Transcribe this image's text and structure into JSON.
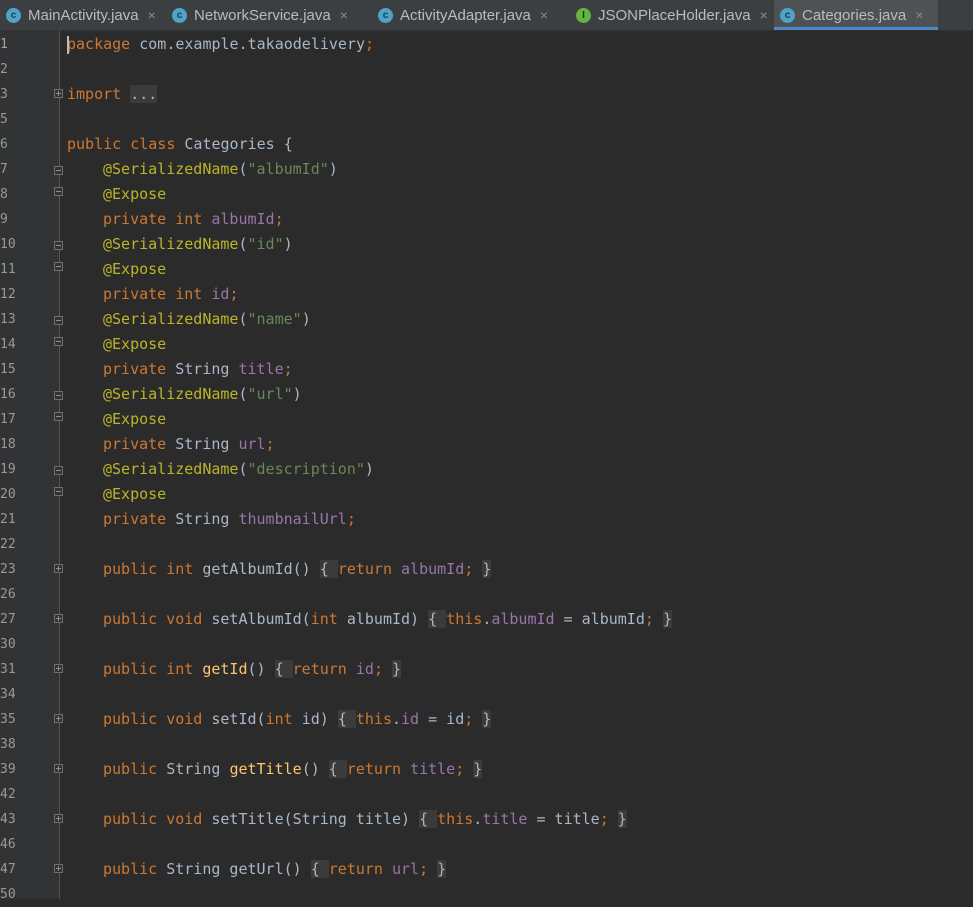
{
  "tabs": [
    {
      "label": "MainActivity.java",
      "icon": "class-icon",
      "active": false
    },
    {
      "label": "NetworkService.java",
      "icon": "class-icon",
      "active": false
    },
    {
      "label": "ActivityAdapter.java",
      "icon": "class-icon",
      "active": false
    },
    {
      "label": "JSONPlaceHolder.java",
      "icon": "interface-icon",
      "active": false
    },
    {
      "label": "Categories.java",
      "icon": "class-icon",
      "active": true
    }
  ],
  "tab_icon_letters": {
    "class": "c",
    "interface": "I"
  },
  "close_glyph": "×",
  "lines": [
    {
      "n": "1",
      "fold": "",
      "tokens": [
        [
          "kw",
          "package"
        ],
        [
          "plain",
          " com.example.takaodelivery"
        ],
        [
          "punct",
          ";"
        ]
      ]
    },
    {
      "n": "2",
      "fold": "",
      "tokens": []
    },
    {
      "n": "3",
      "fold": "plus",
      "tokens": [
        [
          "kw",
          "import"
        ],
        [
          "plain",
          " "
        ],
        [
          "folded",
          "..."
        ]
      ]
    },
    {
      "n": "5",
      "fold": "",
      "tokens": []
    },
    {
      "n": "6",
      "fold": "",
      "tokens": [
        [
          "kw",
          "public class"
        ],
        [
          "plain",
          " Categories {"
        ]
      ]
    },
    {
      "n": "7",
      "fold": "open",
      "indent": 1,
      "tokens": [
        [
          "ann",
          "@SerializedName"
        ],
        [
          "plain",
          "("
        ],
        [
          "str",
          "\"albumId\""
        ],
        [
          "plain",
          ")"
        ]
      ]
    },
    {
      "n": "8",
      "fold": "close",
      "indent": 1,
      "tokens": [
        [
          "ann",
          "@Expose"
        ]
      ]
    },
    {
      "n": "9",
      "fold": "",
      "indent": 1,
      "tokens": [
        [
          "kw",
          "private int "
        ],
        [
          "fld",
          "albumId"
        ],
        [
          "punct",
          ";"
        ]
      ]
    },
    {
      "n": "10",
      "fold": "open",
      "indent": 1,
      "tokens": [
        [
          "ann",
          "@SerializedName"
        ],
        [
          "plain",
          "("
        ],
        [
          "str",
          "\"id\""
        ],
        [
          "plain",
          ")"
        ]
      ]
    },
    {
      "n": "11",
      "fold": "close",
      "indent": 1,
      "tokens": [
        [
          "ann",
          "@Expose"
        ]
      ]
    },
    {
      "n": "12",
      "fold": "",
      "indent": 1,
      "tokens": [
        [
          "kw",
          "private int "
        ],
        [
          "fld",
          "id"
        ],
        [
          "punct",
          ";"
        ]
      ]
    },
    {
      "n": "13",
      "fold": "open",
      "indent": 1,
      "tokens": [
        [
          "ann",
          "@SerializedName"
        ],
        [
          "plain",
          "("
        ],
        [
          "str",
          "\"name\""
        ],
        [
          "plain",
          ")"
        ]
      ]
    },
    {
      "n": "14",
      "fold": "close",
      "indent": 1,
      "tokens": [
        [
          "ann",
          "@Expose"
        ]
      ]
    },
    {
      "n": "15",
      "fold": "",
      "indent": 1,
      "tokens": [
        [
          "kw",
          "private "
        ],
        [
          "plain",
          "String "
        ],
        [
          "fld",
          "title"
        ],
        [
          "punct",
          ";"
        ]
      ]
    },
    {
      "n": "16",
      "fold": "open",
      "indent": 1,
      "tokens": [
        [
          "ann",
          "@SerializedName"
        ],
        [
          "plain",
          "("
        ],
        [
          "str",
          "\"url\""
        ],
        [
          "plain",
          ")"
        ]
      ]
    },
    {
      "n": "17",
      "fold": "close",
      "indent": 1,
      "tokens": [
        [
          "ann",
          "@Expose"
        ]
      ]
    },
    {
      "n": "18",
      "fold": "",
      "indent": 1,
      "tokens": [
        [
          "kw",
          "private "
        ],
        [
          "plain",
          "String "
        ],
        [
          "fld",
          "url"
        ],
        [
          "punct",
          ";"
        ]
      ]
    },
    {
      "n": "19",
      "fold": "open",
      "indent": 1,
      "tokens": [
        [
          "ann",
          "@SerializedName"
        ],
        [
          "plain",
          "("
        ],
        [
          "str",
          "\"description\""
        ],
        [
          "plain",
          ")"
        ]
      ]
    },
    {
      "n": "20",
      "fold": "close",
      "indent": 1,
      "tokens": [
        [
          "ann",
          "@Expose"
        ]
      ]
    },
    {
      "n": "21",
      "fold": "",
      "indent": 1,
      "tokens": [
        [
          "kw",
          "private "
        ],
        [
          "plain",
          "String "
        ],
        [
          "fld",
          "thumbnailUrl"
        ],
        [
          "punct",
          ";"
        ]
      ]
    },
    {
      "n": "22",
      "fold": "",
      "tokens": []
    },
    {
      "n": "23",
      "fold": "plus",
      "indent": 1,
      "tokens": [
        [
          "kw",
          "public int "
        ],
        [
          "plain",
          "getAlbumId() "
        ],
        [
          "folded",
          "{ "
        ],
        [
          "kw",
          "return "
        ],
        [
          "fld",
          "albumId"
        ],
        [
          "punct",
          "; "
        ],
        [
          "folded",
          "}"
        ]
      ]
    },
    {
      "n": "26",
      "fold": "",
      "tokens": []
    },
    {
      "n": "27",
      "fold": "plus",
      "indent": 1,
      "tokens": [
        [
          "kw",
          "public void "
        ],
        [
          "plain",
          "setAlbumId("
        ],
        [
          "kw",
          "int "
        ],
        [
          "plain",
          "albumId) "
        ],
        [
          "folded",
          "{ "
        ],
        [
          "kw",
          "this"
        ],
        [
          "plain",
          "."
        ],
        [
          "fld",
          "albumId"
        ],
        [
          "plain",
          " = albumId"
        ],
        [
          "punct",
          "; "
        ],
        [
          "folded",
          "}"
        ]
      ]
    },
    {
      "n": "30",
      "fold": "",
      "tokens": []
    },
    {
      "n": "31",
      "fold": "plus",
      "indent": 1,
      "tokens": [
        [
          "kw",
          "public int "
        ],
        [
          "mth",
          "getId"
        ],
        [
          "plain",
          "() "
        ],
        [
          "folded",
          "{ "
        ],
        [
          "kw",
          "return "
        ],
        [
          "fld",
          "id"
        ],
        [
          "punct",
          "; "
        ],
        [
          "folded",
          "}"
        ]
      ]
    },
    {
      "n": "34",
      "fold": "",
      "tokens": []
    },
    {
      "n": "35",
      "fold": "plus",
      "indent": 1,
      "tokens": [
        [
          "kw",
          "public void "
        ],
        [
          "plain",
          "setId("
        ],
        [
          "kw",
          "int "
        ],
        [
          "plain",
          "id) "
        ],
        [
          "folded",
          "{ "
        ],
        [
          "kw",
          "this"
        ],
        [
          "plain",
          "."
        ],
        [
          "fld",
          "id"
        ],
        [
          "plain",
          " = id"
        ],
        [
          "punct",
          "; "
        ],
        [
          "folded",
          "}"
        ]
      ]
    },
    {
      "n": "38",
      "fold": "",
      "tokens": []
    },
    {
      "n": "39",
      "fold": "plus",
      "indent": 1,
      "tokens": [
        [
          "kw",
          "public "
        ],
        [
          "plain",
          "String "
        ],
        [
          "mth",
          "getTitle"
        ],
        [
          "plain",
          "() "
        ],
        [
          "folded",
          "{ "
        ],
        [
          "kw",
          "return "
        ],
        [
          "fld",
          "title"
        ],
        [
          "punct",
          "; "
        ],
        [
          "folded",
          "}"
        ]
      ]
    },
    {
      "n": "42",
      "fold": "",
      "tokens": []
    },
    {
      "n": "43",
      "fold": "plus",
      "indent": 1,
      "tokens": [
        [
          "kw",
          "public void "
        ],
        [
          "plain",
          "setTitle(String title) "
        ],
        [
          "folded",
          "{ "
        ],
        [
          "kw",
          "this"
        ],
        [
          "plain",
          "."
        ],
        [
          "fld",
          "title"
        ],
        [
          "plain",
          " = title"
        ],
        [
          "punct",
          "; "
        ],
        [
          "folded",
          "}"
        ]
      ]
    },
    {
      "n": "46",
      "fold": "",
      "tokens": []
    },
    {
      "n": "47",
      "fold": "plus",
      "indent": 1,
      "tokens": [
        [
          "kw",
          "public "
        ],
        [
          "plain",
          "String getUrl() "
        ],
        [
          "folded",
          "{ "
        ],
        [
          "kw",
          "return "
        ],
        [
          "fld",
          "url"
        ],
        [
          "punct",
          "; "
        ],
        [
          "folded",
          "}"
        ]
      ]
    },
    {
      "n": "50",
      "fold": "",
      "tokens": []
    }
  ]
}
